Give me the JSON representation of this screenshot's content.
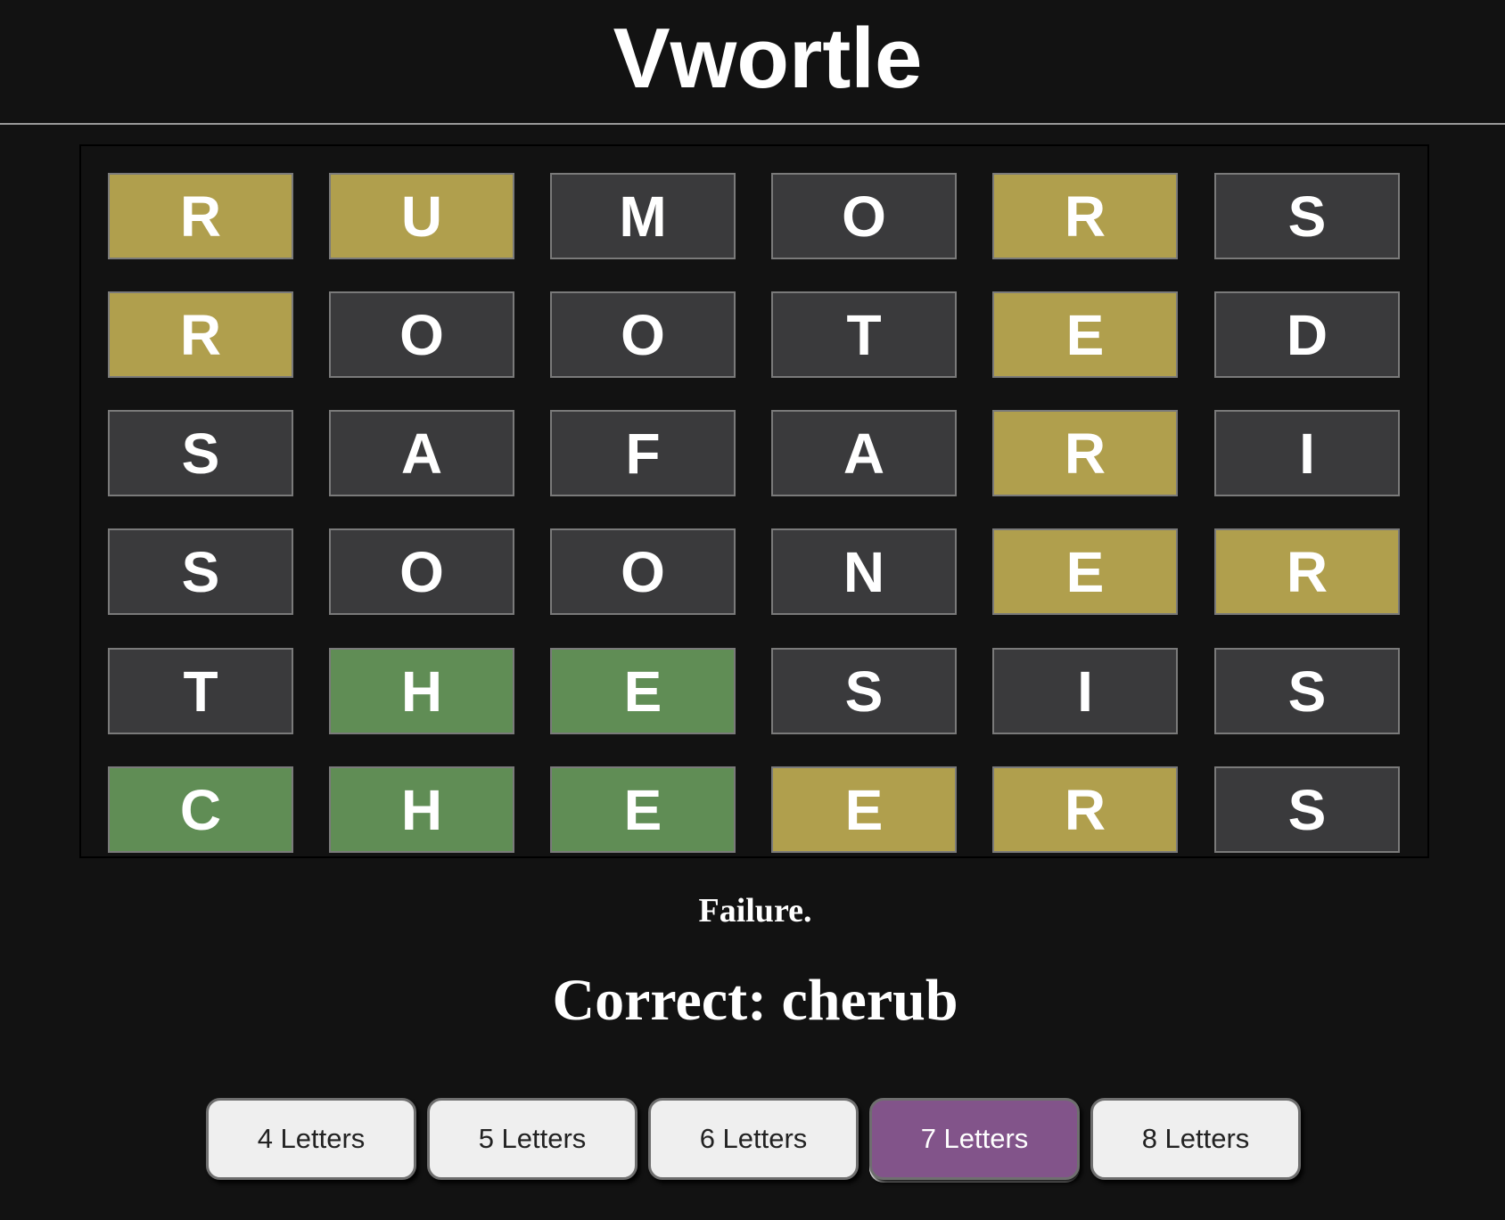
{
  "app": {
    "title": "Vwortle"
  },
  "colors": {
    "correct": "#608d55",
    "present": "#b09f4d",
    "absent": "#3a3a3c",
    "active_button": "#82548a",
    "button": "#efefef"
  },
  "board": {
    "rows": [
      {
        "tiles": [
          {
            "letter": "R",
            "state": "present"
          },
          {
            "letter": "U",
            "state": "present"
          },
          {
            "letter": "M",
            "state": "absent"
          },
          {
            "letter": "O",
            "state": "absent"
          },
          {
            "letter": "R",
            "state": "present"
          },
          {
            "letter": "S",
            "state": "absent"
          }
        ]
      },
      {
        "tiles": [
          {
            "letter": "R",
            "state": "present"
          },
          {
            "letter": "O",
            "state": "absent"
          },
          {
            "letter": "O",
            "state": "absent"
          },
          {
            "letter": "T",
            "state": "absent"
          },
          {
            "letter": "E",
            "state": "present"
          },
          {
            "letter": "D",
            "state": "absent"
          }
        ]
      },
      {
        "tiles": [
          {
            "letter": "S",
            "state": "absent"
          },
          {
            "letter": "A",
            "state": "absent"
          },
          {
            "letter": "F",
            "state": "absent"
          },
          {
            "letter": "A",
            "state": "absent"
          },
          {
            "letter": "R",
            "state": "present"
          },
          {
            "letter": "I",
            "state": "absent"
          }
        ]
      },
      {
        "tiles": [
          {
            "letter": "S",
            "state": "absent"
          },
          {
            "letter": "O",
            "state": "absent"
          },
          {
            "letter": "O",
            "state": "absent"
          },
          {
            "letter": "N",
            "state": "absent"
          },
          {
            "letter": "E",
            "state": "present"
          },
          {
            "letter": "R",
            "state": "present"
          }
        ]
      },
      {
        "tiles": [
          {
            "letter": "T",
            "state": "absent"
          },
          {
            "letter": "H",
            "state": "correct"
          },
          {
            "letter": "E",
            "state": "correct"
          },
          {
            "letter": "S",
            "state": "absent"
          },
          {
            "letter": "I",
            "state": "absent"
          },
          {
            "letter": "S",
            "state": "absent"
          }
        ]
      },
      {
        "tiles": [
          {
            "letter": "C",
            "state": "correct"
          },
          {
            "letter": "H",
            "state": "correct"
          },
          {
            "letter": "E",
            "state": "correct"
          },
          {
            "letter": "E",
            "state": "present"
          },
          {
            "letter": "R",
            "state": "present"
          },
          {
            "letter": "S",
            "state": "absent"
          }
        ]
      }
    ]
  },
  "result": {
    "message": "Failure.",
    "answer": "Correct: cherub"
  },
  "length_options": [
    {
      "label": "4 Letters",
      "selected": false
    },
    {
      "label": "5 Letters",
      "selected": false
    },
    {
      "label": "6 Letters",
      "selected": false
    },
    {
      "label": "7 Letters",
      "selected": true
    },
    {
      "label": "8 Letters",
      "selected": false
    }
  ]
}
